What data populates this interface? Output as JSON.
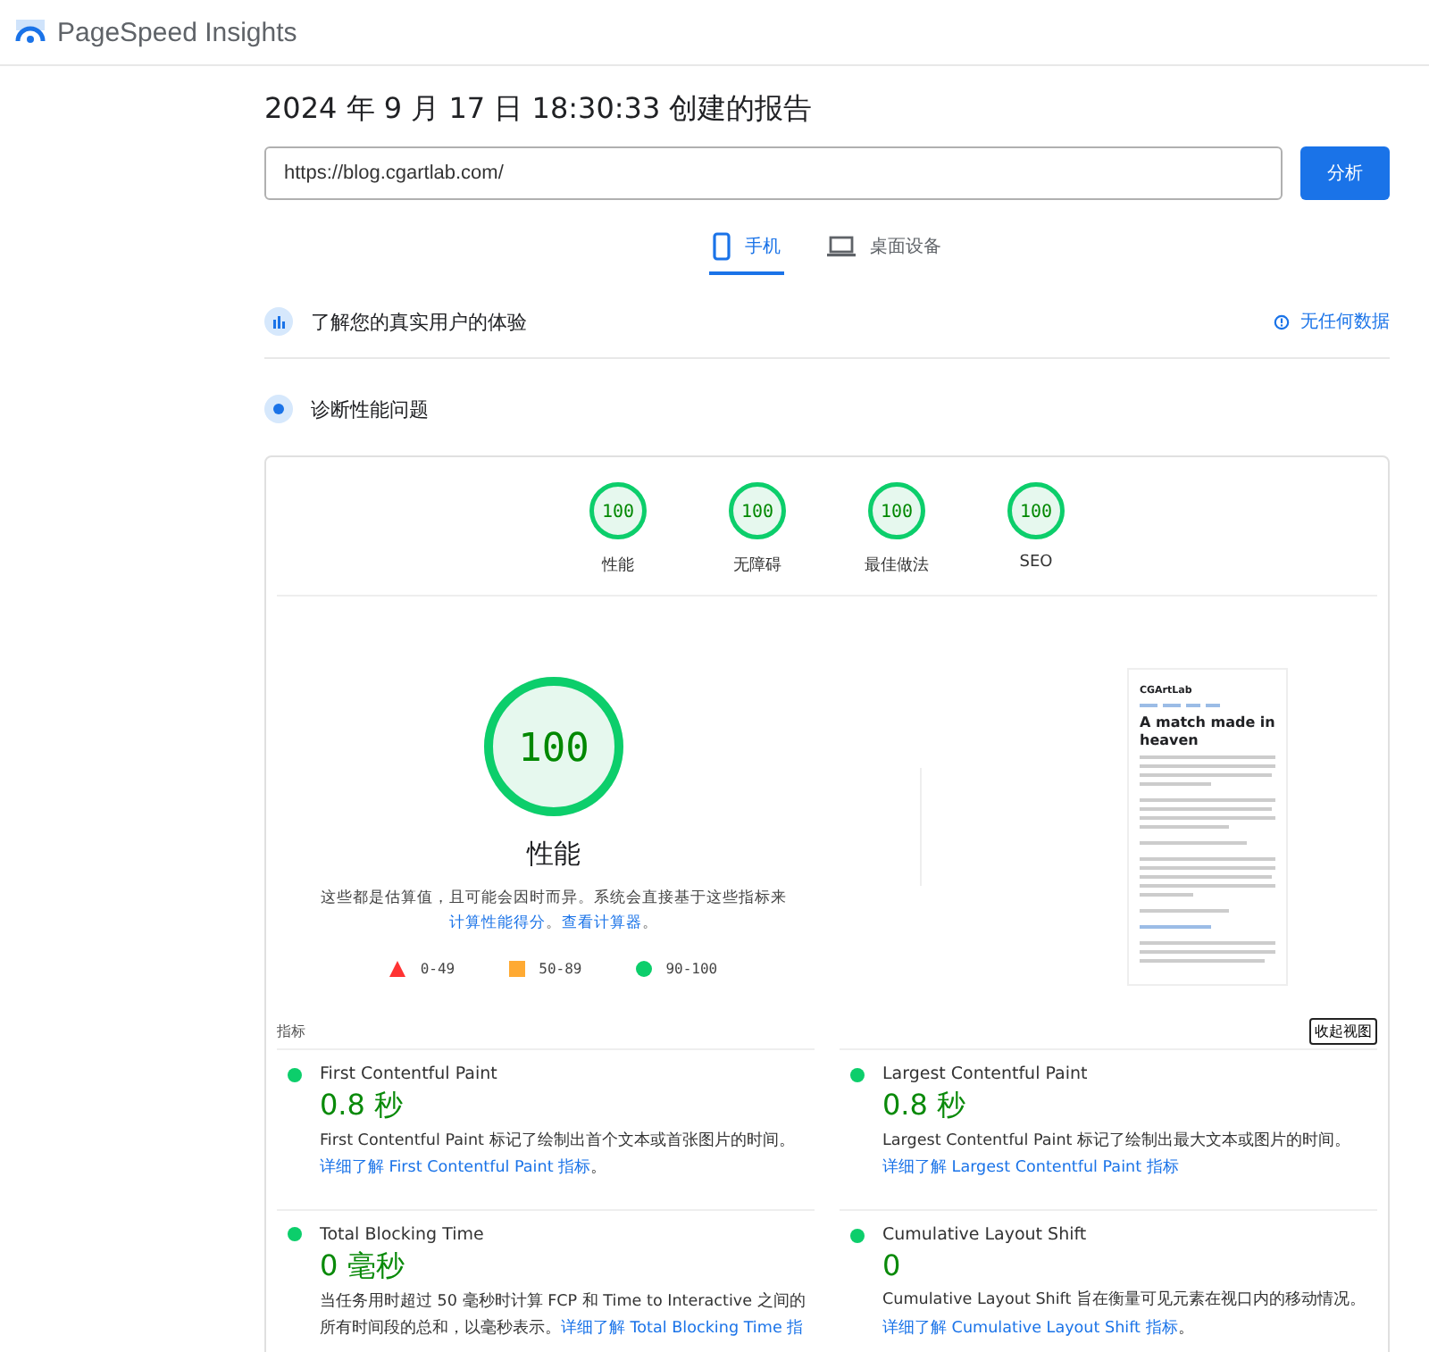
{
  "header": {
    "title": "PageSpeed Insights"
  },
  "report_title": "2024 年 9 月 17 日 18:30:33 创建的报告",
  "url_field": {
    "value": "https://blog.cgartlab.com/"
  },
  "analyze_button": "分析",
  "device_tabs": [
    {
      "label": "手机",
      "kind": "phone",
      "selected": true
    },
    {
      "label": "桌面设备",
      "kind": "laptop",
      "selected": false
    }
  ],
  "field_data": {
    "title": "了解您的真实用户的体验",
    "status": "无任何数据"
  },
  "diagnose": {
    "title": "诊断性能问题"
  },
  "score_gauges": [
    {
      "score": "100",
      "label": "性能",
      "level": 1
    },
    {
      "score": "100",
      "label": "无障碍",
      "level": 1
    },
    {
      "score": "100",
      "label": "最佳做法",
      "level": 1
    },
    {
      "score": "100",
      "label": "SEO",
      "level": 1
    }
  ],
  "performance": {
    "score": "100",
    "level": 1,
    "title": "性能",
    "description": [
      {
        "text": "这些都是估算值，且可能会因时而异。系统会直接基于这些指标来",
        "link": false
      },
      {
        "text": "计算性能得分",
        "link": true
      },
      {
        "text": "。",
        "link": false
      },
      {
        "text": "查看计算器",
        "link": true
      },
      {
        "text": "。",
        "link": false
      }
    ]
  },
  "legend": [
    {
      "kind": "triangle",
      "range": "0-49",
      "color": "#ff3333"
    },
    {
      "kind": "square",
      "range": "50-89",
      "color": "#ffaa33"
    },
    {
      "kind": "circle",
      "range": "90-100",
      "color": "#0cce6b"
    }
  ],
  "page_screenshot": {
    "site_name": "CGArtLab",
    "heading": "A match made in heaven"
  },
  "metrics_section": {
    "label": "指标",
    "toggle": "收起视图",
    "metrics": [
      {
        "name": "First Contentful Paint",
        "value": "0.8 秒",
        "description": "First Contentful Paint 标记了绘制出首个文本或首张图片的时间。",
        "link": "详细了解 First Contentful Paint 指标",
        "end": "。",
        "color": "#0cce6b"
      },
      {
        "name": "Largest Contentful Paint",
        "value": "0.8 秒",
        "description": "Largest Contentful Paint 标记了绘制出最大文本或图片的时间。",
        "link": "详细了解 Largest Contentful Paint 指标",
        "color": "#0cce6b"
      },
      {
        "name": "Total Blocking Time",
        "value": "0 毫秒",
        "description": "当任务用时超过 50 毫秒时计算 FCP 和 Time to Interactive 之间的所有时间段的总和，以毫秒表示。",
        "link": "详细了解 Total Blocking Time 指",
        "color": "#0cce6b"
      },
      {
        "name": "Cumulative Layout Shift",
        "value": "0",
        "description": "Cumulative Layout Shift 旨在衡量可见元素在视口内的移动情况。",
        "link": "详细了解 Cumulative Layout Shift 指标",
        "end": "。",
        "color": "#0cce6b"
      }
    ]
  }
}
